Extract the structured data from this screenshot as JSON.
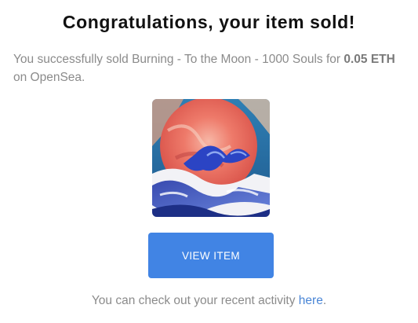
{
  "email": {
    "title": "Congratulations, your item sold!",
    "message_prefix": "You successfully sold ",
    "item_name": "Burning - To the Moon - 1000 Souls",
    "message_middle": " for ",
    "price": "0.05 ETH",
    "message_suffix": " on OpenSea.",
    "item_image_icon": "nft-artwork-image",
    "button_label": "VIEW ITEM",
    "footer_prefix": "You can check out your recent activity ",
    "footer_link": "here",
    "footer_suffix": "."
  },
  "colors": {
    "accent": "#4184e4",
    "link": "#4a86d6",
    "text_muted": "#8b8b8b",
    "title": "#111111"
  }
}
